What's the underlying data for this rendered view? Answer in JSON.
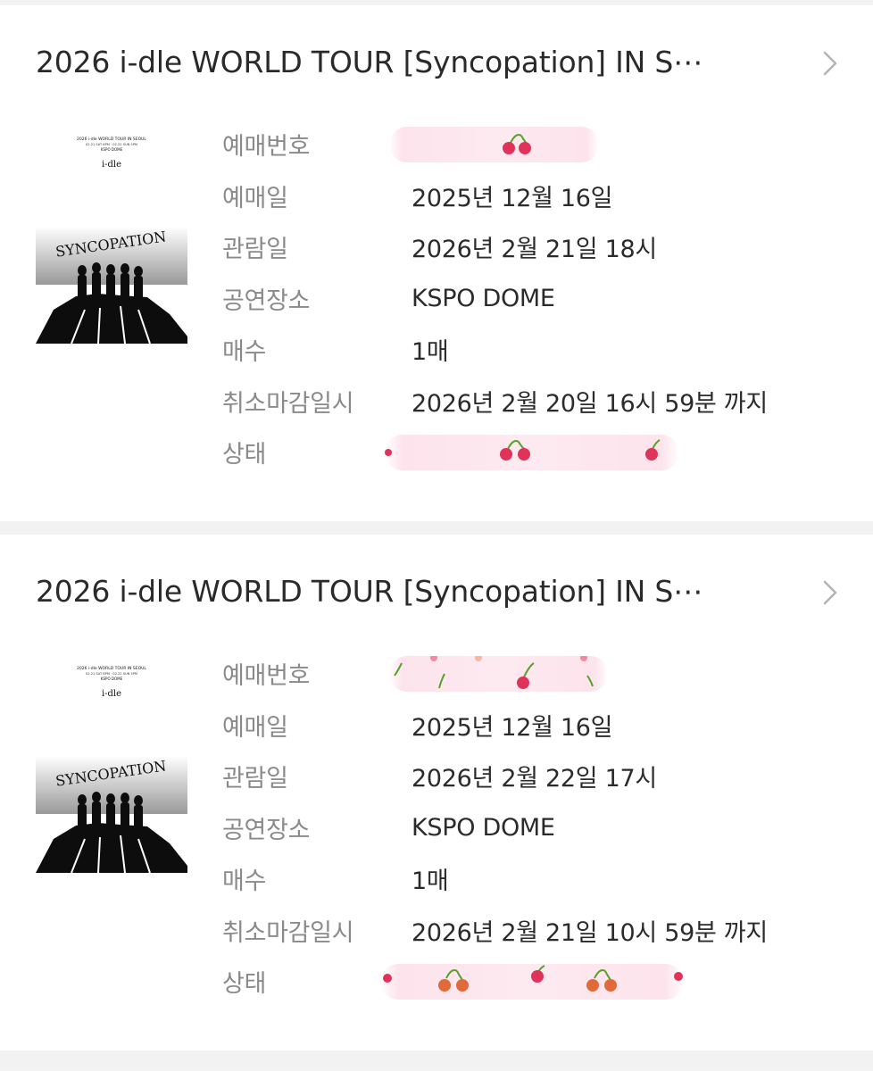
{
  "tickets": [
    {
      "title": "2026 i-dle WORLD TOUR [Syncopation] IN S⋯",
      "poster": {
        "header_lines": [
          "2026 i-dle WORLD TOUR IN SEOUL",
          "02.21 SAT 6PM · 02.22 SUN 5PM",
          "KSPO DOME"
        ],
        "logo": "i-dle",
        "word": "SYNCOPATION"
      },
      "rows": [
        {
          "label": "예매번호",
          "value": ""
        },
        {
          "label": "예매일",
          "value": "2025년 12월 16일"
        },
        {
          "label": "관람일",
          "value": "2026년 2월 21일 18시"
        },
        {
          "label": "공연장소",
          "value": "KSPO DOME"
        },
        {
          "label": "매수",
          "value": "1매"
        },
        {
          "label": "취소마감일시",
          "value": "2026년 2월 20일 16시 59분 까지"
        },
        {
          "label": "상태",
          "value": ""
        }
      ]
    },
    {
      "title": "2026 i-dle WORLD TOUR [Syncopation] IN S⋯",
      "poster": {
        "header_lines": [
          "2026 i-dle WORLD TOUR IN SEOUL",
          "02.21 SAT 6PM · 02.22 SUN 5PM",
          "KSPO DOME"
        ],
        "logo": "i-dle",
        "word": "SYNCOPATION"
      },
      "rows": [
        {
          "label": "예매번호",
          "value": ""
        },
        {
          "label": "예매일",
          "value": "2025년 12월 16일"
        },
        {
          "label": "관람일",
          "value": "2026년 2월 22일 17시"
        },
        {
          "label": "공연장소",
          "value": "KSPO DOME"
        },
        {
          "label": "매수",
          "value": "1매"
        },
        {
          "label": "취소마감일시",
          "value": "2026년 2월 21일 10시 59분 까지"
        },
        {
          "label": "상태",
          "value": ""
        }
      ]
    }
  ],
  "icons": {
    "chevron": "chevron-right-icon",
    "mask_sticker": "cherry-icon"
  },
  "colors": {
    "title": "#2a2a2a",
    "label": "#8a8a8a",
    "value": "#2b2b2b",
    "cherry": "#e0335a",
    "cherry_stem": "#5aa02c",
    "mask": "#fde3ec"
  }
}
